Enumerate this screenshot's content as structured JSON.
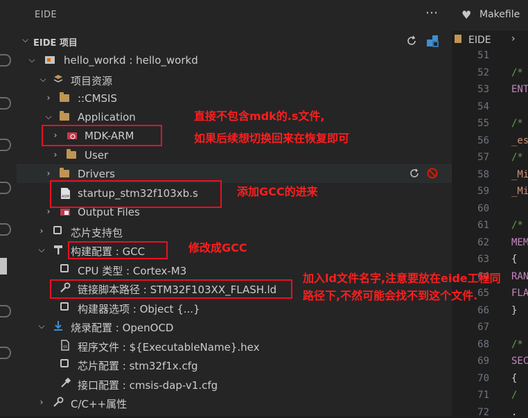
{
  "sidebar": {
    "title": "EIDE",
    "section": "EIDE 项目",
    "tree": [
      {
        "label": "hello_workd : hello_workd"
      },
      {
        "label": "项目资源"
      },
      {
        "label": "::CMSIS"
      },
      {
        "label": "Application"
      },
      {
        "label": "MDK-ARM"
      },
      {
        "label": "User"
      },
      {
        "label": "Drivers"
      },
      {
        "label": "startup_stm32f103xb.s"
      },
      {
        "label": "Output Files"
      },
      {
        "label": "芯片支持包"
      },
      {
        "label": "构建配置 : GCC"
      },
      {
        "label": "CPU 类型 : Cortex-M3"
      },
      {
        "label": "链接脚本路径 : STM32F103XX_FLASH.ld"
      },
      {
        "label": "构建器选项 : Object {...}"
      },
      {
        "label": "烧录配置 : OpenOCD"
      },
      {
        "label": "程序文件 : ${ExecutableName}.hex"
      },
      {
        "label": "芯片配置 : stm32f1x.cfg"
      },
      {
        "label": "接口配置 : cmsis-dap-v1.cfg"
      },
      {
        "label": "C/C++属性"
      }
    ]
  },
  "editor": {
    "tab": "Makefile",
    "breadcrumb": "EIDE",
    "lines": [
      {
        "n": "51",
        "text": ""
      },
      {
        "n": "52",
        "text": "/*"
      },
      {
        "n": "53",
        "text": "ENT"
      },
      {
        "n": "54",
        "text": ""
      },
      {
        "n": "55",
        "text": "/*"
      },
      {
        "n": "56",
        "text": "_es"
      },
      {
        "n": "57",
        "text": "/*"
      },
      {
        "n": "58",
        "text": "_Mi"
      },
      {
        "n": "59",
        "text": "_Mi"
      },
      {
        "n": "60",
        "text": ""
      },
      {
        "n": "61",
        "text": "/*"
      },
      {
        "n": "62",
        "text": "MEM"
      },
      {
        "n": "63",
        "text": "{"
      },
      {
        "n": "64",
        "text": "RAN"
      },
      {
        "n": "65",
        "text": "FLA"
      },
      {
        "n": "66",
        "text": "}"
      },
      {
        "n": "67",
        "text": ""
      },
      {
        "n": "68",
        "text": "/*"
      },
      {
        "n": "69",
        "text": "SEC"
      },
      {
        "n": "70",
        "text": "{"
      },
      {
        "n": "71",
        "text": "/"
      },
      {
        "n": "72",
        "text": "."
      }
    ]
  },
  "annotations": [
    {
      "text": "直接不包含mdk的.s文件,"
    },
    {
      "text": "如果后续想切换回来在恢复即可"
    },
    {
      "text": "添加GCC的进来"
    },
    {
      "text": "修改成GCC"
    },
    {
      "text": "加入ld文件名字,注意要放在eide工程同"
    },
    {
      "text": "路径下,不然可能会找不到这个文件."
    }
  ],
  "colors": {
    "annotation": "#ff1e1e",
    "folder": "#c09553",
    "background": "#1e1e1e"
  }
}
